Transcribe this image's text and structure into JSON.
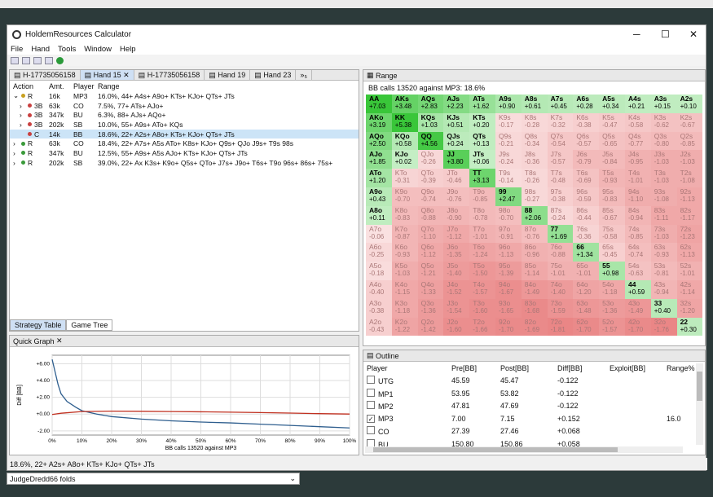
{
  "app": {
    "title": "HoldemResources Calculator",
    "menu": [
      "File",
      "Hand",
      "Tools",
      "Window",
      "Help"
    ]
  },
  "hand_tabs": [
    "H-17735056158",
    "Hand 15",
    "H-17735056158",
    "Hand 19",
    "Hand 23"
  ],
  "hand_tabs_more": "»₅",
  "action_table": {
    "headers": [
      "Action",
      "Amt.",
      "Player",
      "Range"
    ],
    "rows": [
      {
        "action": "R",
        "amt": "16k",
        "player": "MP3",
        "range": "16.0%, 44+ A4s+ A9o+ KTs+ KJo+ QTs+ JTs",
        "color": "#c8a020",
        "exp": "⌄",
        "indent": 0,
        "sel": false
      },
      {
        "action": "3B",
        "amt": "63k",
        "player": "CO",
        "range": "7.5%, 77+ ATs+ AJo+",
        "color": "#c94040",
        "exp": "›",
        "indent": 1,
        "sel": false
      },
      {
        "action": "3B",
        "amt": "347k",
        "player": "BU",
        "range": "6.3%, 88+ AJs+ AQo+",
        "color": "#c94040",
        "exp": "›",
        "indent": 1,
        "sel": false
      },
      {
        "action": "3B",
        "amt": "202k",
        "player": "SB",
        "range": "10.0%, 55+ A9s+ ATo+ KQs",
        "color": "#c94040",
        "exp": "›",
        "indent": 1,
        "sel": false
      },
      {
        "action": "C",
        "amt": "14k",
        "player": "BB",
        "range": "18.6%, 22+ A2s+ A8o+ KTs+ KJo+ QTs+ JTs",
        "color": "#c94040",
        "exp": "",
        "indent": 1,
        "sel": true
      },
      {
        "action": "R",
        "amt": "63k",
        "player": "CO",
        "range": "18.4%, 22+ A7s+ A5s ATo+ K8s+ KJo+ Q9s+ QJo J9s+ T9s 98s",
        "color": "#3a9a3a",
        "exp": "›",
        "indent": 0,
        "sel": false
      },
      {
        "action": "R",
        "amt": "347k",
        "player": "BU",
        "range": "12.5%, 55+ A9s+ A5s AJo+ KTs+ KJo+ QTs+ JTs",
        "color": "#3a9a3a",
        "exp": "›",
        "indent": 0,
        "sel": false
      },
      {
        "action": "R",
        "amt": "202k",
        "player": "SB",
        "range": "39.0%, 22+ Ax K3s+ K9o+ Q5s+ QTo+ J7s+ J9o+ T6s+ T9o 96s+ 86s+ 75s+",
        "color": "#3a9a3a",
        "exp": "›",
        "indent": 0,
        "sel": false
      }
    ],
    "bottom_tabs": [
      "Strategy Table",
      "Game Tree"
    ]
  },
  "quick_graph": {
    "tab": "Quick Graph"
  },
  "chart_data": {
    "type": "line",
    "xlabel": "BB calls 13520 against MP3",
    "ylabel": "Diff [BB]",
    "x_ticks": [
      "0%",
      "10%",
      "20%",
      "30%",
      "40%",
      "50%",
      "60%",
      "70%",
      "80%",
      "90%",
      "100%"
    ],
    "y_ticks": [
      "+6.00",
      "+4.00",
      "+2.00",
      "+0.00",
      "-2.00"
    ],
    "ylim": [
      -2.5,
      7
    ],
    "grid": true,
    "series": [
      {
        "color": "#2e5e8e",
        "x": [
          0,
          1,
          2,
          3,
          5,
          8,
          10,
          15,
          20,
          30,
          40,
          50,
          60,
          70,
          80,
          90,
          100
        ],
        "y": [
          6.5,
          5.0,
          3.5,
          2.4,
          1.5,
          0.8,
          0.4,
          0.0,
          -0.3,
          -0.6,
          -0.8,
          -0.95,
          -1.05,
          -1.2,
          -1.35,
          -1.5,
          -1.65
        ]
      },
      {
        "color": "#c03020",
        "x": [
          0,
          3,
          10,
          20,
          30,
          40,
          50,
          60,
          70,
          80,
          90,
          100
        ],
        "y": [
          -0.05,
          0.1,
          0.3,
          0.35,
          0.33,
          0.3,
          0.27,
          0.23,
          0.18,
          0.12,
          0.05,
          0.0
        ]
      }
    ]
  },
  "range": {
    "tab": "Range",
    "subtitle": "BB calls 13520 against MP3: 18.6%",
    "cells": [
      [
        "AA|+7.03",
        "AKs|+3.48",
        "AQs|+2.83",
        "AJs|+2.23",
        "ATs|+1.62",
        "A9s|+0.90",
        "A8s|+0.61",
        "A7s|+0.45",
        "A6s|+0.28",
        "A5s|+0.34",
        "A4s|+0.21",
        "A3s|+0.15",
        "A2s|+0.10"
      ],
      [
        "AKo|+3.19",
        "KK|+5.38",
        "KQs|+1.03",
        "KJs|+0.51",
        "KTs|+0.20",
        "K9s|-0.17",
        "K8s|-0.28",
        "K7s|-0.32",
        "K6s|-0.38",
        "K5s|-0.47",
        "K4s|-0.58",
        "K3s|-0.62",
        "K2s|-0.67"
      ],
      [
        "AQo|+2.50",
        "KQo|+0.58",
        "QQ|+4.56",
        "QJs|+0.24",
        "QTs|+0.13",
        "Q9s|-0.21",
        "Q8s|-0.34",
        "Q7s|-0.54",
        "Q6s|-0.57",
        "Q5s|-0.65",
        "Q4s|-0.77",
        "Q3s|-0.80",
        "Q2s|-0.85"
      ],
      [
        "AJo|+1.85",
        "KJo|+0.02",
        "QJo|-0.26",
        "JJ|+3.80",
        "JTs|+0.06",
        "J9s|-0.24",
        "J8s|-0.36",
        "J7s|-0.57",
        "J6s|-0.79",
        "J5s|-0.84",
        "J4s|-0.95",
        "J3s|-1.03",
        "J2s|-1.03"
      ],
      [
        "ATo|+1.20",
        "KTo|-0.31",
        "QTo|-0.39",
        "JTo|-0.46",
        "TT|+3.13",
        "T9s|-0.14",
        "T8s|-0.26",
        "T7s|-0.48",
        "T6s|-0.69",
        "T5s|-0.93",
        "T4s|-1.01",
        "T3s|-1.03",
        "T2s|-1.08"
      ],
      [
        "A9o|+0.43",
        "K9o|-0.70",
        "Q9o|-0.74",
        "J9o|-0.76",
        "T9o|-0.85",
        "99|+2.47",
        "98s|-0.27",
        "97s|-0.38",
        "96s|-0.59",
        "95s|-0.83",
        "94s|-1.10",
        "93s|-1.08",
        "92s|-1.13"
      ],
      [
        "A8o|+0.11",
        "K8o|-0.83",
        "Q8o|-0.88",
        "J8o|-0.90",
        "T8o|-0.78",
        "98o|-0.70",
        "88|+2.06",
        "87s|-0.24",
        "86s|-0.44",
        "85s|-0.67",
        "84s|-0.94",
        "83s|-1.11",
        "82s|-1.17"
      ],
      [
        "A7o|-0.06",
        "K7o|-0.87",
        "Q7o|-1.10",
        "J7o|-1.12",
        "T7o|-1.01",
        "97o|-0.91",
        "87o|-0.76",
        "77|+1.69",
        "76s|-0.36",
        "75s|-0.58",
        "74s|-0.85",
        "73s|-1.03",
        "72s|-1.23"
      ],
      [
        "A6o|-0.25",
        "K6o|-0.93",
        "Q6o|-1.12",
        "J6o|-1.35",
        "T6o|-1.24",
        "96o|-1.13",
        "86o|-0.96",
        "76o|-0.88",
        "66|+1.34",
        "65s|-0.45",
        "64s|-0.74",
        "63s|-0.93",
        "62s|-1.13"
      ],
      [
        "A5o|-0.18",
        "K5o|-1.03",
        "Q5o|-1.21",
        "J5o|-1.40",
        "T5o|-1.50",
        "95o|-1.39",
        "85o|-1.14",
        "75o|-1.01",
        "65o|-1.01",
        "55|+0.98",
        "54s|-0.63",
        "53s|-0.81",
        "52s|-1.01"
      ],
      [
        "A4o|-0.40",
        "K4o|-1.15",
        "Q4o|-1.33",
        "J4o|-1.52",
        "T4o|-1.57",
        "94o|-1.67",
        "84o|-1.49",
        "74o|-1.40",
        "64o|-1.20",
        "54o|-1.18",
        "44|+0.59",
        "43s|-0.94",
        "42s|-1.14"
      ],
      [
        "A3o|-0.38",
        "K3o|-1.18",
        "Q3o|-1.36",
        "J3o|-1.54",
        "T3o|-1.60",
        "93o|-1.65",
        "83o|-1.68",
        "73o|-1.59",
        "63o|-1.48",
        "53o|-1.36",
        "43o|-1.49",
        "33|+0.40",
        "32s|-1.20"
      ],
      [
        "A2o|-0.43",
        "K2o|-1.22",
        "Q2o|-1.42",
        "J2o|-1.60",
        "T2o|-1.66",
        "92o|-1.70",
        "82o|-1.69",
        "72o|-1.81",
        "62o|-1.70",
        "52o|-1.57",
        "42o|-1.70",
        "32o|-1.76",
        "22|+0.30"
      ]
    ]
  },
  "outline": {
    "tab": "Outline",
    "headers": [
      "Player",
      "Pre[BB]",
      "Post[BB]",
      "Diff[BB]",
      "Exploit[BB]",
      "Range%"
    ],
    "rows": [
      {
        "player": "UTG",
        "pre": "45.59",
        "post": "45.47",
        "diff": "-0.122",
        "exploit": "",
        "range": "",
        "checked": false
      },
      {
        "player": "MP1",
        "pre": "53.95",
        "post": "53.82",
        "diff": "-0.122",
        "exploit": "",
        "range": "",
        "checked": false
      },
      {
        "player": "MP2",
        "pre": "47.81",
        "post": "47.69",
        "diff": "-0.122",
        "exploit": "",
        "range": "",
        "checked": false
      },
      {
        "player": "MP3",
        "pre": "7.00",
        "post": "7.15",
        "diff": "+0.152",
        "exploit": "",
        "range": "16.0",
        "checked": true
      },
      {
        "player": "CO",
        "pre": "27.39",
        "post": "27.46",
        "diff": "+0.068",
        "exploit": "",
        "range": "",
        "checked": false
      },
      {
        "player": "BU",
        "pre": "150.80",
        "post": "150.86",
        "diff": "+0.058",
        "exploit": "",
        "range": "",
        "checked": false
      }
    ]
  },
  "status": "18.6%, 22+ A2s+ A8o+ KTs+ KJo+ QTs+ JTs",
  "chat": "JudgeDredd66 folds"
}
